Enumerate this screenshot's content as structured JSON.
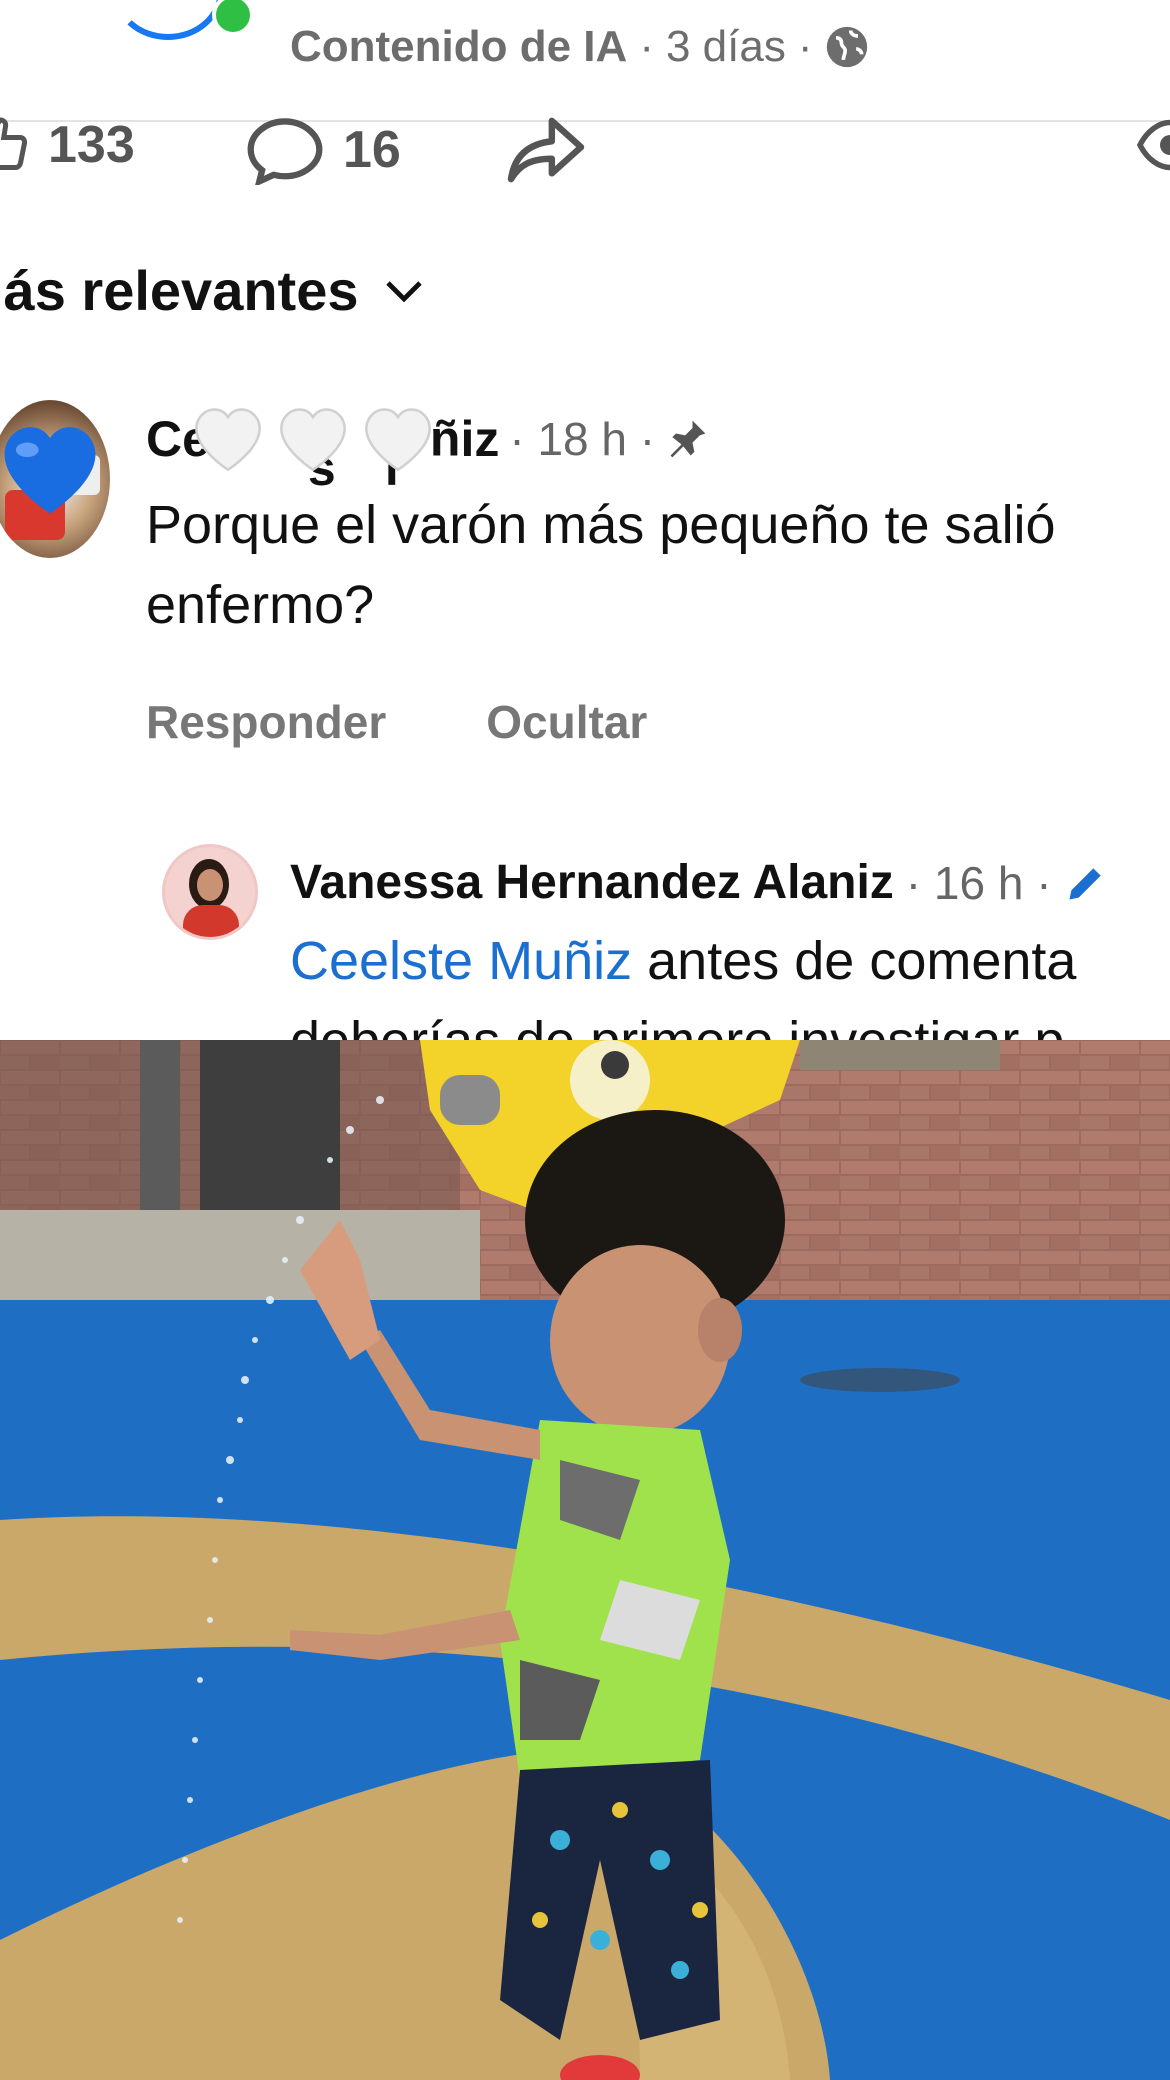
{
  "post": {
    "content_label": "Contenido de IA",
    "time": "3 días",
    "separator": "·"
  },
  "reactions": {
    "likes": "133",
    "comments": "16"
  },
  "sort": {
    "label": "lás relevantes"
  },
  "comment": {
    "author_left": "Ce",
    "author_mid": "s",
    "author_mid2": "l",
    "author_right": "ñiz",
    "time": "· 18 h ·",
    "text": "Porque el varón más pequeño te salió enfermo?",
    "reply_label": "Responder",
    "hide_label": "Ocultar"
  },
  "reply": {
    "author": "Vanessa Hernandez Alaniz",
    "time": "· 16 h ·",
    "mention": "Ceelste Muñiz",
    "text": " antes de comenta",
    "text_line2": "deberías de primero investigar p"
  },
  "colors": {
    "accent": "#1877f2",
    "mention": "#1b6fd1",
    "online": "#2fbf44",
    "pool_blue": "#1e6fc4",
    "ground_tan": "#c9a86a"
  }
}
